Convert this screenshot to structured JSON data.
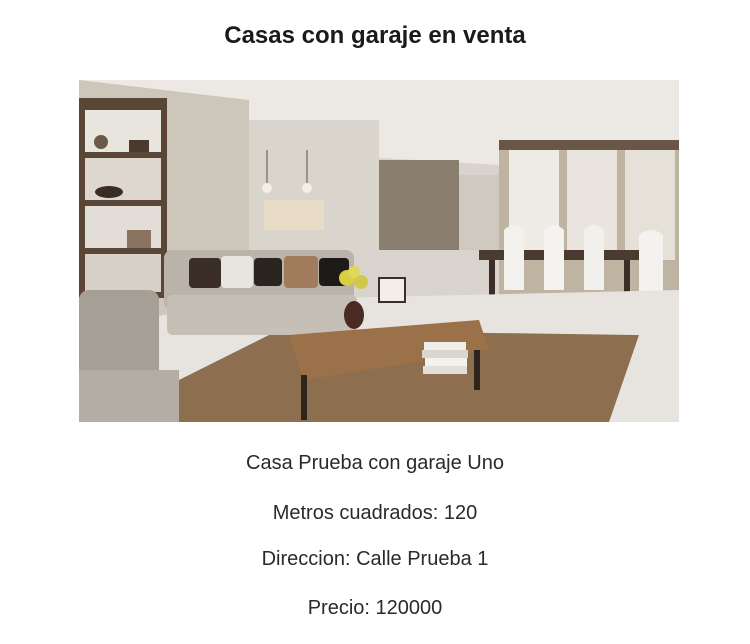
{
  "page": {
    "title": "Casas con garaje en venta"
  },
  "listing": {
    "photo_icon": "living-room-photo",
    "name": "Casa Prueba con garaje Uno",
    "area_text": "Metros cuadrados: 120",
    "address_text": "Direccion: Calle Prueba 1",
    "price_text": "Precio: 120000"
  }
}
